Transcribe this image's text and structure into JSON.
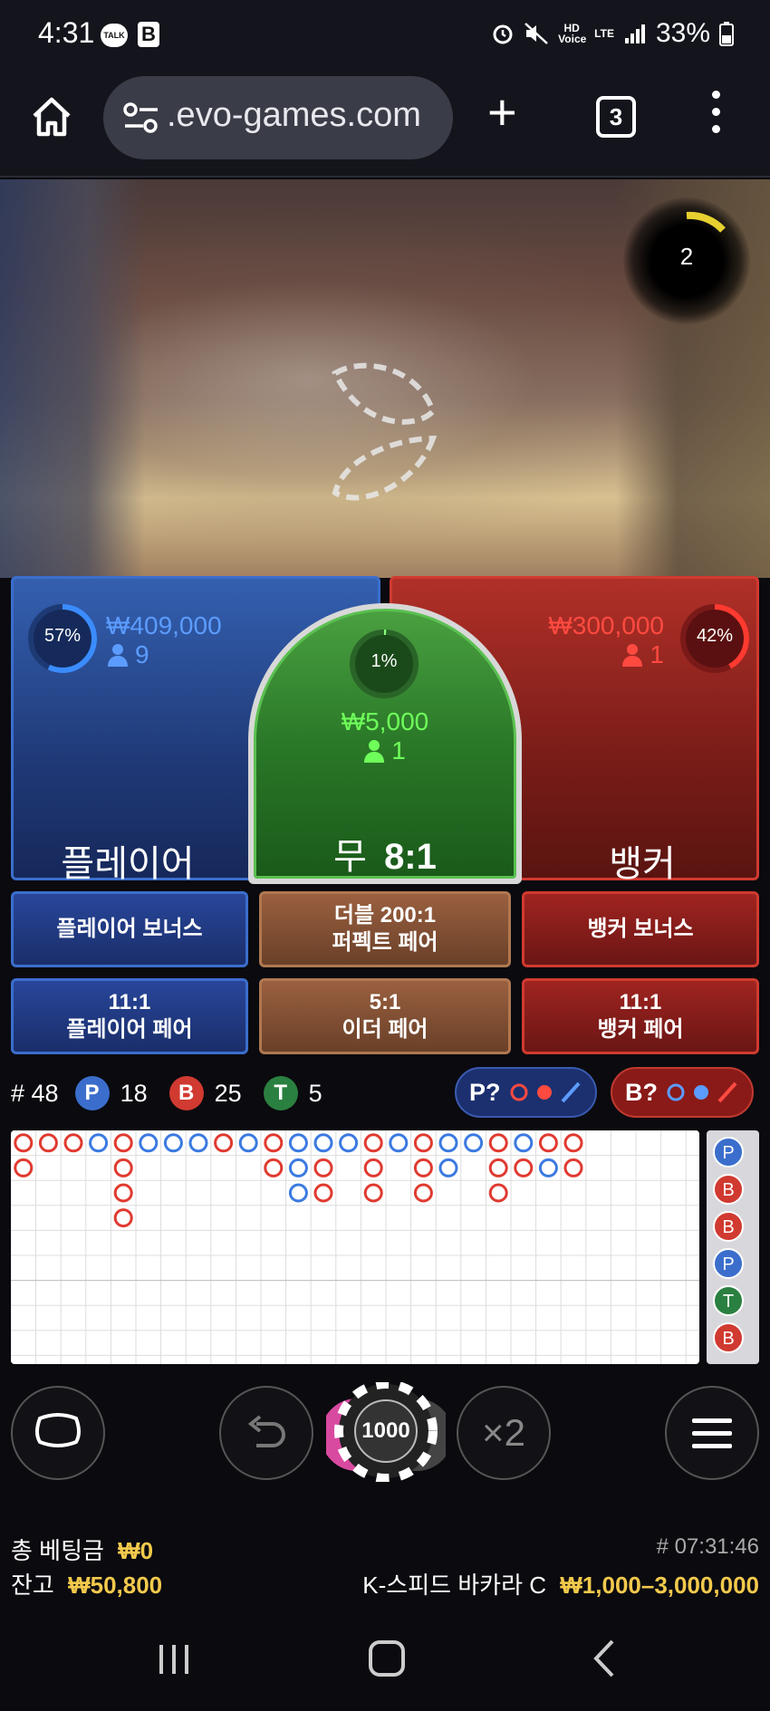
{
  "status_bar": {
    "time": "4:31",
    "talk_icon_text": "TALK",
    "b_icon_text": "B",
    "hd_voice": "HD Voice",
    "network": "LTE",
    "battery": "33%"
  },
  "browser": {
    "url": ".evo-games.com",
    "tab_count": "3"
  },
  "video": {
    "round_timer": "2"
  },
  "bets": {
    "player": {
      "percent": "57%",
      "percent_value": 57,
      "amount": "₩409,000",
      "players": "9",
      "label": "플레이어"
    },
    "tie": {
      "percent": "1%",
      "percent_value": 1,
      "amount": "₩5,000",
      "players": "1",
      "label": "무",
      "payout": "8:1"
    },
    "banker": {
      "percent": "42%",
      "percent_value": 42,
      "amount": "₩300,000",
      "players": "1",
      "label": "뱅커"
    }
  },
  "side_bets": {
    "player_bonus": "플레이어 보너스",
    "perfect_pair_line1": "더블 200:1",
    "perfect_pair_line2": "퍼펙트 페어",
    "banker_bonus": "뱅커 보너스",
    "player_pair_line1": "11:1",
    "player_pair_line2": "플레이어 페어",
    "either_pair_line1": "5:1",
    "either_pair_line2": "이더 페어",
    "banker_pair_line1": "11:1",
    "banker_pair_line2": "뱅커 페어"
  },
  "stats": {
    "round": "# 48",
    "p_letter": "P",
    "p_count": "18",
    "b_letter": "B",
    "b_count": "25",
    "t_letter": "T",
    "t_count": "5",
    "p_predict": "P?",
    "b_predict": "B?"
  },
  "roadmap": {
    "big_road": [
      [
        "B",
        "B",
        "B",
        "P",
        "B",
        "P",
        "P",
        "P",
        "B",
        "P",
        "B",
        "P",
        "P",
        "P",
        "B",
        "P",
        "B",
        "P",
        "P",
        "B",
        "P",
        "B",
        "B"
      ],
      [
        "B",
        "",
        "",
        "",
        "B",
        "",
        "",
        "",
        "",
        "",
        "B",
        "P",
        "B",
        "",
        "B",
        "",
        "B",
        "P",
        "",
        "B",
        "B",
        "P",
        "B"
      ],
      [
        "",
        "",
        "",
        "",
        "B",
        "",
        "",
        "",
        "",
        "",
        "",
        "P",
        "B",
        "",
        "B",
        "",
        "B",
        "",
        "",
        "B",
        "",
        "",
        ""
      ],
      [
        "",
        "",
        "",
        "",
        "B",
        "",
        "",
        "",
        "",
        "",
        "",
        "",
        "",
        "",
        "",
        "",
        "",
        "",
        "",
        "",
        "",
        "",
        ""
      ]
    ],
    "side_beads": [
      "P",
      "B",
      "B",
      "P",
      "T",
      "B"
    ]
  },
  "controls": {
    "chip_value": "1000",
    "double_label": "×2"
  },
  "footer": {
    "total_bet_label": "총 베팅금",
    "total_bet_value": "₩0",
    "balance_label": "잔고",
    "balance_value": "₩50,800",
    "game_id": "# 07:31:46",
    "table_name": "K-스피드 바카라 C",
    "limits": "₩1,000–3,000,000"
  },
  "colors": {
    "player_blue": "#3b6ecc",
    "banker_red": "#d03a30",
    "tie_green": "#2a7828",
    "gold": "#f2c94c"
  }
}
